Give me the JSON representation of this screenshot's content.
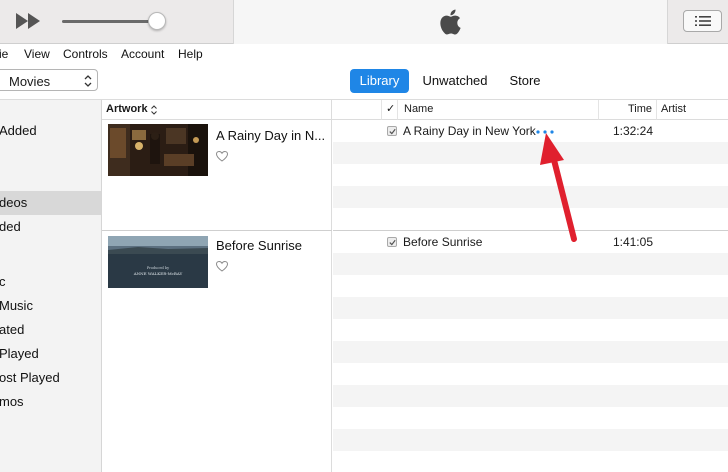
{
  "menu": [
    "ie",
    "View",
    "Controls",
    "Account",
    "Help"
  ],
  "toolbar": {
    "media_kind": "Movies",
    "tabs": [
      "Library",
      "Unwatched",
      "Store"
    ],
    "active_tab": "Library"
  },
  "sidebar": {
    "items": [
      "Added",
      "deos",
      "ded",
      "c",
      "Music",
      "ated",
      "Played",
      "ost Played",
      "mos"
    ],
    "selected": "deos"
  },
  "columns": {
    "artwork": "Artwork",
    "check": "✓",
    "name": "Name",
    "time": "Time",
    "artist": "Artist"
  },
  "albums": [
    {
      "title": "A Rainy Day in N..."
    },
    {
      "title": "Before Sunrise",
      "poster_credit_line1": "Produced by",
      "poster_credit_line2": "ANNE WALKER-McBAY"
    }
  ],
  "tracks": [
    {
      "name": "A Rainy Day in New York",
      "time": "1:32:24"
    },
    {
      "name": "Before Sunrise",
      "time": "1:41:05"
    }
  ],
  "icons": {
    "fast_forward": "fast-forward-icon",
    "apple": "apple-logo-icon",
    "list": "list-icon",
    "heart": "heart-icon",
    "more": "more-options-icon",
    "checkbox": "checkbox-icon",
    "arrow": "red-annotation-arrow"
  },
  "colors": {
    "accent": "#1f86e6",
    "annotation": "#e0202e",
    "more_dots": "#1f86e6"
  }
}
